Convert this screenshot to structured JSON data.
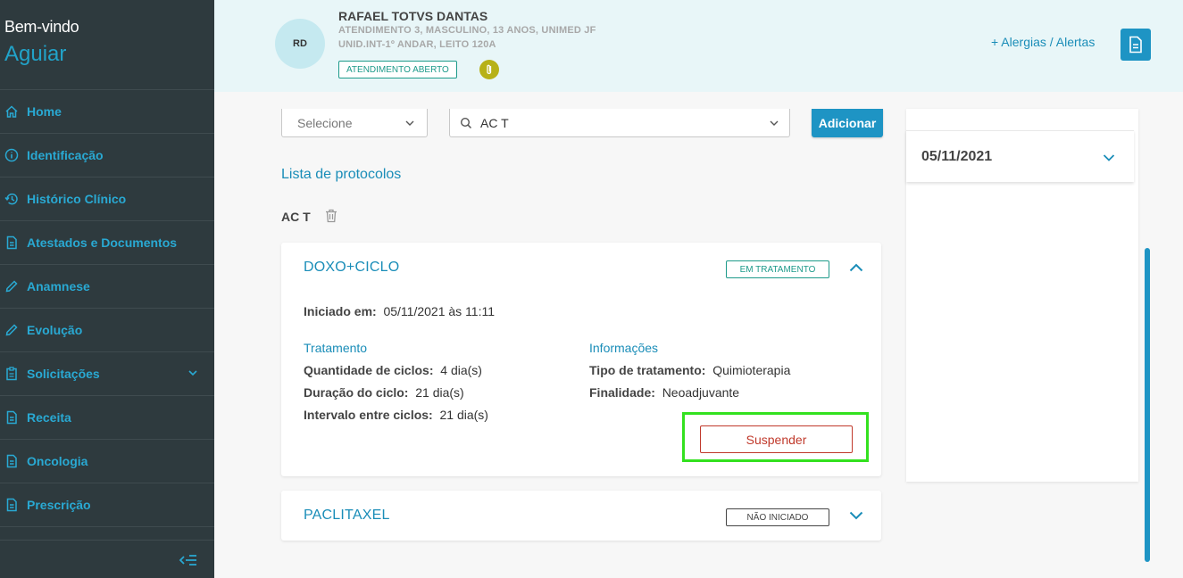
{
  "sidebar": {
    "welcome": "Bem-vindo",
    "username": "Aguiar",
    "items": [
      {
        "label": "Home",
        "icon": "home-icon"
      },
      {
        "label": "Identificação",
        "icon": "info-icon"
      },
      {
        "label": "Histórico Clínico",
        "icon": "history-icon"
      },
      {
        "label": "Atestados e Documentos",
        "icon": "document-icon"
      },
      {
        "label": "Anamnese",
        "icon": "pencil-icon"
      },
      {
        "label": "Evolução",
        "icon": "pencil-icon"
      },
      {
        "label": "Solicitações",
        "icon": "clipboard-icon"
      },
      {
        "label": "Receita",
        "icon": "document-icon"
      },
      {
        "label": "Oncologia",
        "icon": "document-icon"
      },
      {
        "label": "Prescrição",
        "icon": "document-icon"
      }
    ]
  },
  "header": {
    "avatar_initials": "RD",
    "patient_name": "RAFAEL TOTVS DANTAS",
    "patient_info_1": "ATENDIMENTO 3, MASCULINO, 13 ANOS, UNIMED JF",
    "patient_info_2": "UNID.INT-1º ANDAR, LEITO 120A",
    "attendance_status": "ATENDIMENTO ABERTO",
    "alerts_link": "+ Alergias / Alertas"
  },
  "toolbar": {
    "select_placeholder": "Selecione",
    "search_value": "AC T",
    "add_label": "Adicionar"
  },
  "main": {
    "list_title": "Lista de protocolos",
    "protocol_name": "AC T",
    "cards": [
      {
        "title": "DOXO+CICLO",
        "status": "EM TRATAMENTO",
        "started_label": "Iniciado em:",
        "started_value": "05/11/2021 às 11:11",
        "treatment_header": "Tratamento",
        "cycles_label": "Quantidade de ciclos:",
        "cycles_value": "4 dia(s)",
        "duration_label": "Duração do ciclo:",
        "duration_value": "21 dia(s)",
        "interval_label": "Intervalo entre ciclos:",
        "interval_value": "21 dia(s)",
        "info_header": "Informações",
        "type_label": "Tipo de tratamento:",
        "type_value": "Quimioterapia",
        "purpose_label": "Finalidade:",
        "purpose_value": "Neoadjuvante",
        "suspend_label": "Suspender"
      },
      {
        "title": "PACLITAXEL",
        "status": "NÃO INICIADO"
      }
    ]
  },
  "right_panel": {
    "date": "05/11/2021"
  },
  "colors": {
    "sidebar_bg": "#2e3a3e",
    "accent": "#1e94c4",
    "header_bg": "#e8f6f8",
    "suspend": "#c0392b",
    "highlight": "#33e11f"
  }
}
